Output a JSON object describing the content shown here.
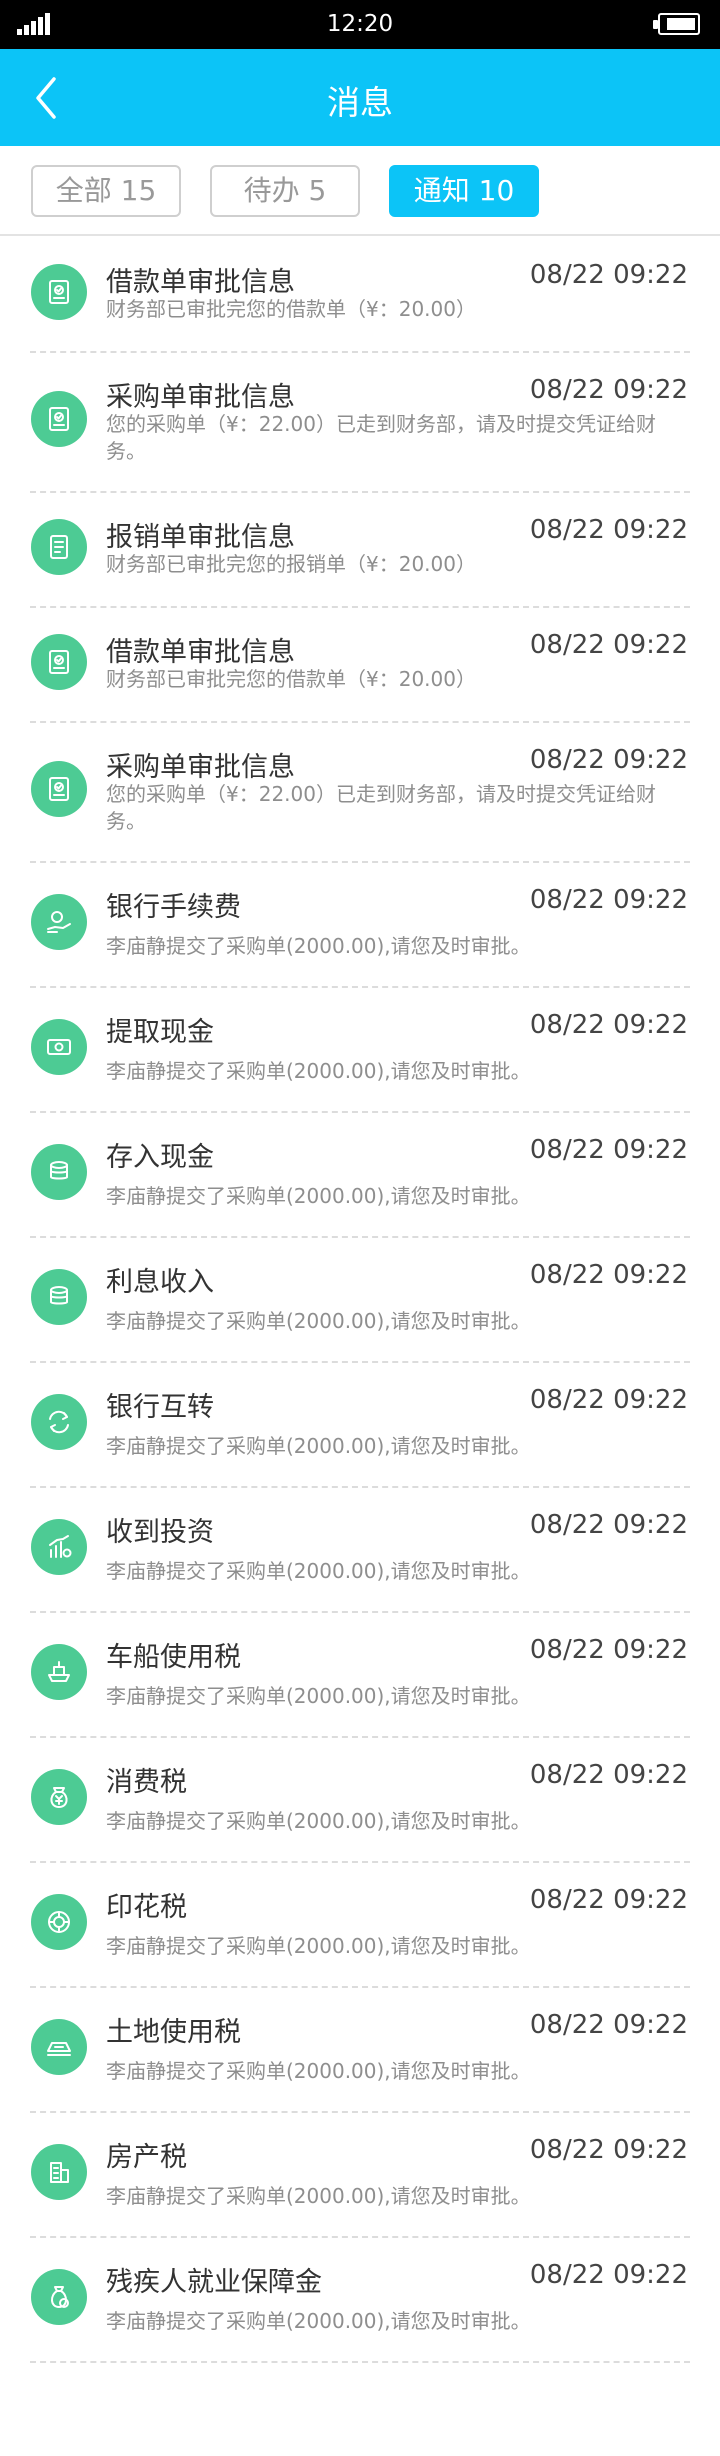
{
  "status_bar": {
    "time": "12:20"
  },
  "nav": {
    "title": "消息"
  },
  "tabs": [
    {
      "label": "全部 15",
      "active": false
    },
    {
      "label": "待办 5",
      "active": false
    },
    {
      "label": "通知 10",
      "active": true
    }
  ],
  "colors": {
    "accent": "#0cc4f7",
    "icon_bg": "#4dcb94"
  },
  "messages": [
    {
      "icon": "document-check-icon",
      "title": "借款单审批信息",
      "time": "08/22 09:22",
      "desc": "财务部已审批完您的借款单（¥：20.00）"
    },
    {
      "icon": "document-check-icon",
      "title": "采购单审批信息",
      "time": "08/22 09:22",
      "desc": "您的采购单（¥：22.00）已走到财务部，请及时提交凭证给财务。"
    },
    {
      "icon": "receipt-icon",
      "title": "报销单审批信息",
      "time": "08/22 09:22",
      "desc": "财务部已审批完您的报销单（¥：20.00）"
    },
    {
      "icon": "document-check-icon",
      "title": "借款单审批信息",
      "time": "08/22 09:22",
      "desc": "财务部已审批完您的借款单（¥：20.00）"
    },
    {
      "icon": "document-check-icon",
      "title": "采购单审批信息",
      "time": "08/22 09:22",
      "desc": "您的采购单（¥：22.00）已走到财务部，请及时提交凭证给财务。"
    },
    {
      "icon": "hand-coin-icon",
      "title": "银行手续费",
      "time": "08/22 09:22",
      "desc": "李庙静提交了采购单(2000.00),请您及时审批。"
    },
    {
      "icon": "cash-icon",
      "title": "提取现金",
      "time": "08/22 09:22",
      "desc": "李庙静提交了采购单(2000.00),请您及时审批。"
    },
    {
      "icon": "coin-stack-icon",
      "title": "存入现金",
      "time": "08/22 09:22",
      "desc": "李庙静提交了采购单(2000.00),请您及时审批。"
    },
    {
      "icon": "coin-stack-icon",
      "title": "利息收入",
      "time": "08/22 09:22",
      "desc": "李庙静提交了采购单(2000.00),请您及时审批。"
    },
    {
      "icon": "transfer-icon",
      "title": "银行互转",
      "time": "08/22 09:22",
      "desc": "李庙静提交了采购单(2000.00),请您及时审批。"
    },
    {
      "icon": "investment-chart-icon",
      "title": "收到投资",
      "time": "08/22 09:22",
      "desc": "李庙静提交了采购单(2000.00),请您及时审批。"
    },
    {
      "icon": "ship-icon",
      "title": "车船使用税",
      "time": "08/22 09:22",
      "desc": "李庙静提交了采购单(2000.00),请您及时审批。"
    },
    {
      "icon": "yen-bag-icon",
      "title": "消费税",
      "time": "08/22 09:22",
      "desc": "李庙静提交了采购单(2000.00),请您及时审批。"
    },
    {
      "icon": "stamp-icon",
      "title": "印花税",
      "time": "08/22 09:22",
      "desc": "李庙静提交了采购单(2000.00),请您及时审批。"
    },
    {
      "icon": "land-icon",
      "title": "土地使用税",
      "time": "08/22 09:22",
      "desc": "李庙静提交了采购单(2000.00),请您及时审批。"
    },
    {
      "icon": "building-icon",
      "title": "房产税",
      "time": "08/22 09:22",
      "desc": "李庙静提交了采购单(2000.00),请您及时审批。"
    },
    {
      "icon": "money-bag-icon",
      "title": "残疾人就业保障金",
      "time": "08/22 09:22",
      "desc": "李庙静提交了采购单(2000.00),请您及时审批。"
    }
  ]
}
